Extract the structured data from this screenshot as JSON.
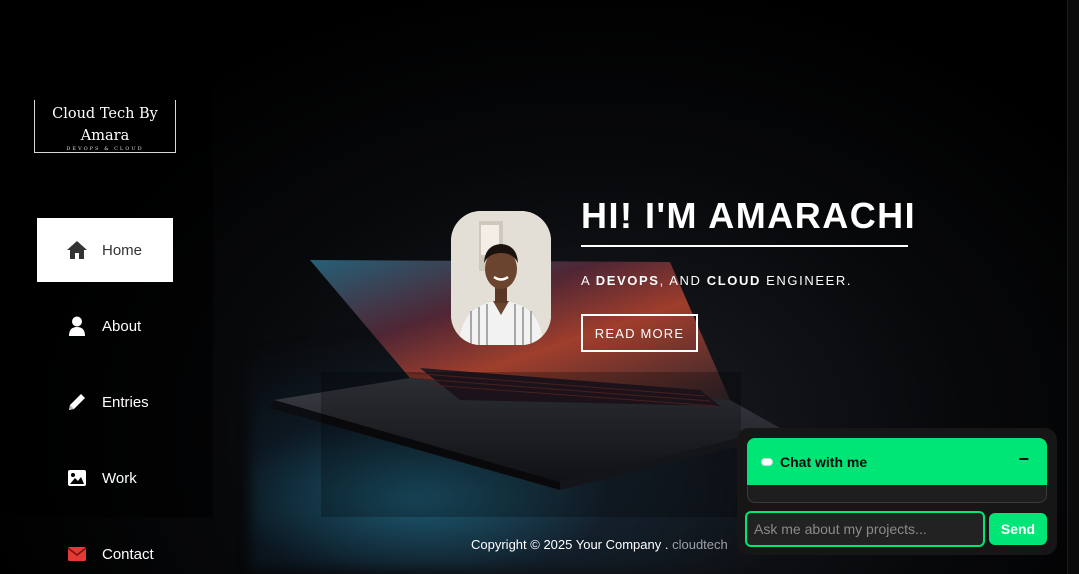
{
  "logo": {
    "title": "Cloud Tech By Amara",
    "tagline": "DEVOPS & CLOUD"
  },
  "nav": {
    "items": [
      {
        "label": "Home",
        "icon": "home-icon",
        "active": true
      },
      {
        "label": "About",
        "icon": "user-icon"
      },
      {
        "label": "Entries",
        "icon": "pencil-icon"
      },
      {
        "label": "Work",
        "icon": "image-icon"
      },
      {
        "label": "Contact",
        "icon": "envelope-icon",
        "icon_color": "#e53935"
      }
    ]
  },
  "hero": {
    "title": "HI! I'M AMARACHI",
    "subtitle_prefix": "A ",
    "subtitle_strong1": "DEVOPS",
    "subtitle_mid": ", AND ",
    "subtitle_strong2": "CLOUD",
    "subtitle_suffix": " ENGINEER.",
    "read_more": "READ MORE"
  },
  "footer": {
    "text": "Copyright © 2025 Your Company . ",
    "link": "cloudtech"
  },
  "chat": {
    "title": "Chat with me",
    "minimize": "−",
    "placeholder": "Ask me about my projects...",
    "send": "Send",
    "accent": "#00e676"
  }
}
